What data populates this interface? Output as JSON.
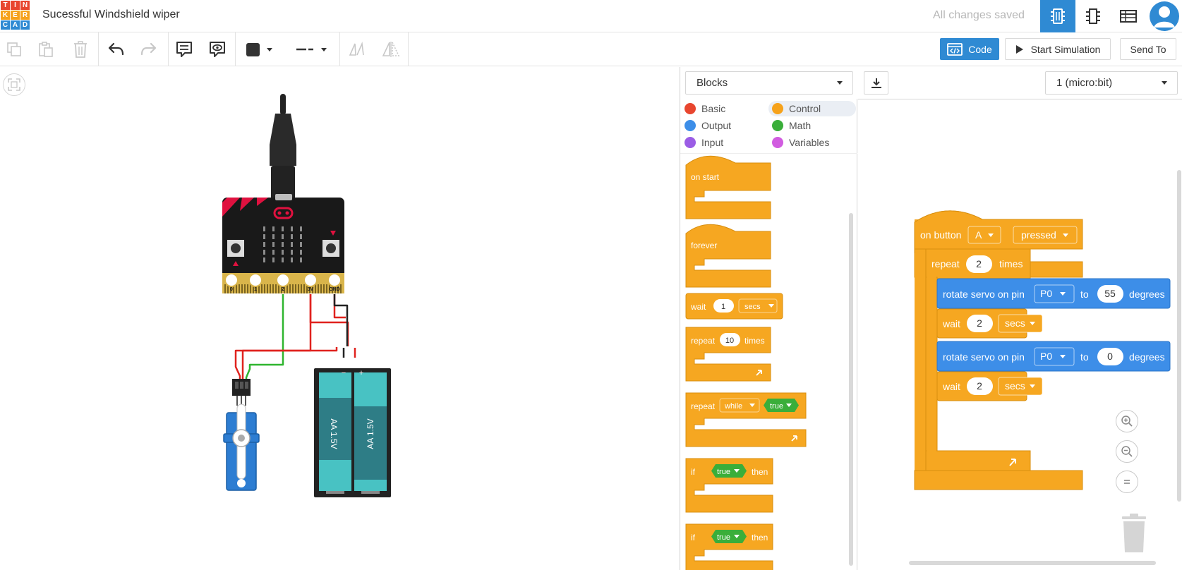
{
  "app": {
    "logo_letters": [
      "T",
      "I",
      "N",
      "K",
      "E",
      "R",
      "C",
      "A",
      "D"
    ],
    "logo_colors": [
      "#e8462f",
      "#e8462f",
      "#e8462f",
      "#f6a21b",
      "#f6a21b",
      "#f6a21b",
      "#2f8ad3",
      "#2f8ad3",
      "#2f8ad3"
    ],
    "title": "Sucessful Windshield wiper",
    "save_status": "All changes saved",
    "accent_color": "#2f8ad3"
  },
  "header_icons": {
    "circuit": "breadboard-view-icon",
    "schematic": "schematic-view-icon",
    "components_list": "component-list-icon",
    "profile": "user-avatar-icon"
  },
  "toolbar": {
    "code_label": "Code",
    "start_simulation_label": "Start Simulation",
    "send_to_label": "Send To"
  },
  "circuit": {
    "microbit_pins": [
      "0",
      "1",
      "2",
      "3V",
      "GND"
    ],
    "battery_labels": [
      "AA 1.5V",
      "AA 1.5V"
    ],
    "battery_terminals": [
      "−",
      "+"
    ]
  },
  "code_panel": {
    "mode_dropdown": "Blocks",
    "device_dropdown": "1 (micro:bit)"
  },
  "categories": [
    {
      "label": "Basic",
      "color": "#e8462f"
    },
    {
      "label": "Control",
      "color": "#f6a21b"
    },
    {
      "label": "Output",
      "color": "#3d8ee8"
    },
    {
      "label": "Math",
      "color": "#3aae3a"
    },
    {
      "label": "Input",
      "color": "#9b5de5"
    },
    {
      "label": "Variables",
      "color": "#d15ce0"
    }
  ],
  "flyout": {
    "on_start": "on start",
    "forever": "forever",
    "wait": "wait",
    "wait_value": "1",
    "wait_unit": "secs",
    "repeat": "repeat",
    "repeat_value": "10",
    "times": "times",
    "repeat_while": "repeat",
    "while": "while",
    "true": "true",
    "if": "if",
    "then": "then"
  },
  "program": {
    "event": "on button",
    "button": "A",
    "action": "pressed",
    "repeat": "repeat",
    "repeat_count": "2",
    "times": "times",
    "rotate": "rotate servo on pin",
    "pin": "P0",
    "to": "to",
    "angle1": "55",
    "angle2": "0",
    "degrees": "degrees",
    "wait": "wait",
    "wait_value": "2",
    "secs": "secs"
  }
}
